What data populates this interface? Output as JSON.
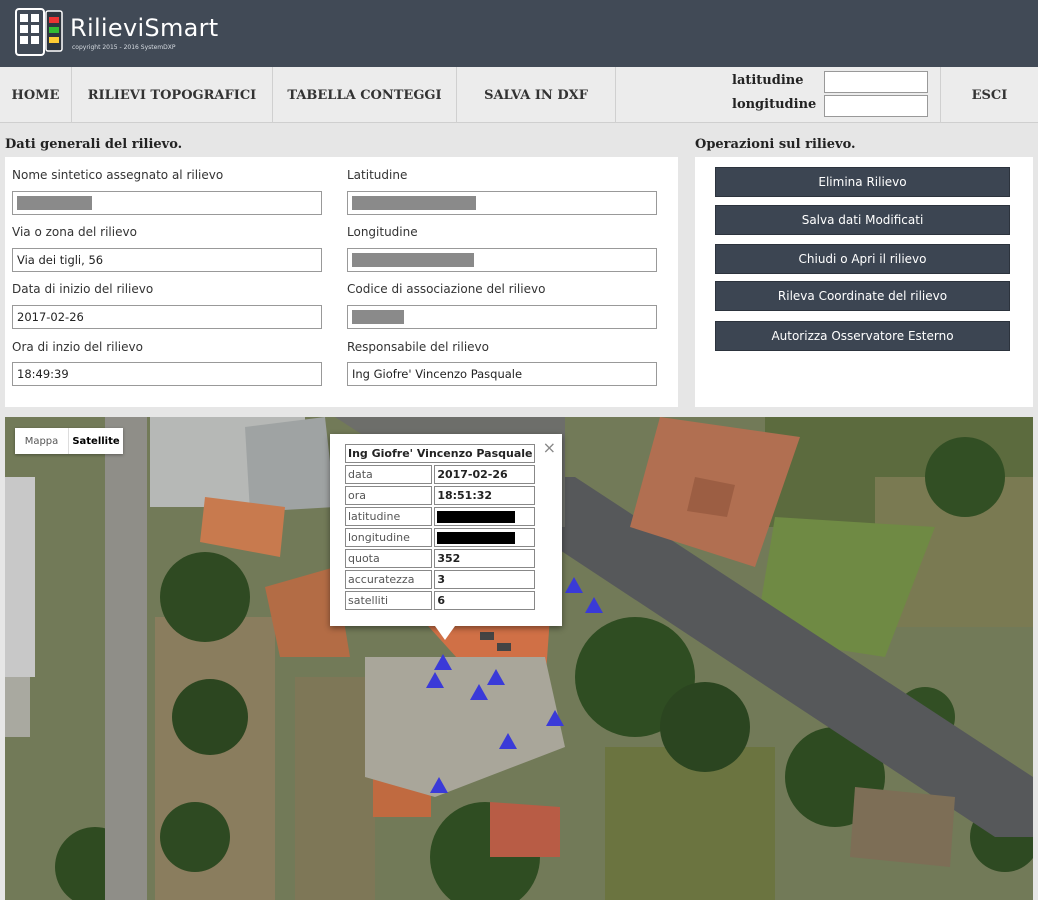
{
  "app": {
    "name": "RilieviSmart",
    "copyright": "copyright 2015 - 2016 SystemDXP"
  },
  "nav": {
    "home": "HOME",
    "rilievi": "RILIEVI TOPOGRAFICI",
    "tabella": "TABELLA CONTEGGI",
    "salva": "SALVA IN DXF",
    "latitudine_label": "latitudine",
    "longitudine_label": "longitudine",
    "latitudine_value": "",
    "longitudine_value": "",
    "esci": "ESCI"
  },
  "general": {
    "title": "Dati generali del rilievo.",
    "fields": {
      "nome_label": "Nome sintetico assegnato al rilievo",
      "nome_value": "",
      "lat_label": "Latitudine",
      "lat_value": "",
      "via_label": "Via o zona del rilievo",
      "via_value": "Via dei tigli, 56",
      "lon_label": "Longitudine",
      "lon_value": "",
      "data_label": "Data di inizio del rilievo",
      "data_value": "2017-02-26",
      "codice_label": "Codice di associazione del rilievo",
      "codice_value": "",
      "ora_label": "Ora di inzio del rilievo",
      "ora_value": "18:49:39",
      "resp_label": "Responsabile del rilievo",
      "resp_value": "Ing Giofre' Vincenzo Pasquale"
    }
  },
  "operations": {
    "title": "Operazioni sul rilievo.",
    "buttons": [
      "Elimina Rilievo",
      "Salva dati Modificati",
      "Chiudi o Apri il rilievo",
      "Rileva Coordinate del rilievo",
      "Autorizza Osservatore Esterno"
    ]
  },
  "map": {
    "type_mappa": "Mappa",
    "type_satellite": "Satellite",
    "selected_type": "Satellite",
    "popup": {
      "title": "Ing Giofre' Vincenzo Pasquale",
      "close": "×",
      "rows": [
        {
          "k": "data",
          "v": "2017-02-26"
        },
        {
          "k": "ora",
          "v": "18:51:32"
        },
        {
          "k": "latitudine",
          "v": ""
        },
        {
          "k": "longitudine",
          "v": ""
        },
        {
          "k": "quota",
          "v": "352"
        },
        {
          "k": "accuratezza",
          "v": "3"
        },
        {
          "k": "satelliti",
          "v": "6"
        }
      ]
    },
    "marker_count": 10
  },
  "colors": {
    "header_bg": "#414a56",
    "button_bg": "#3c4552",
    "marker": "#3a3ad8"
  }
}
